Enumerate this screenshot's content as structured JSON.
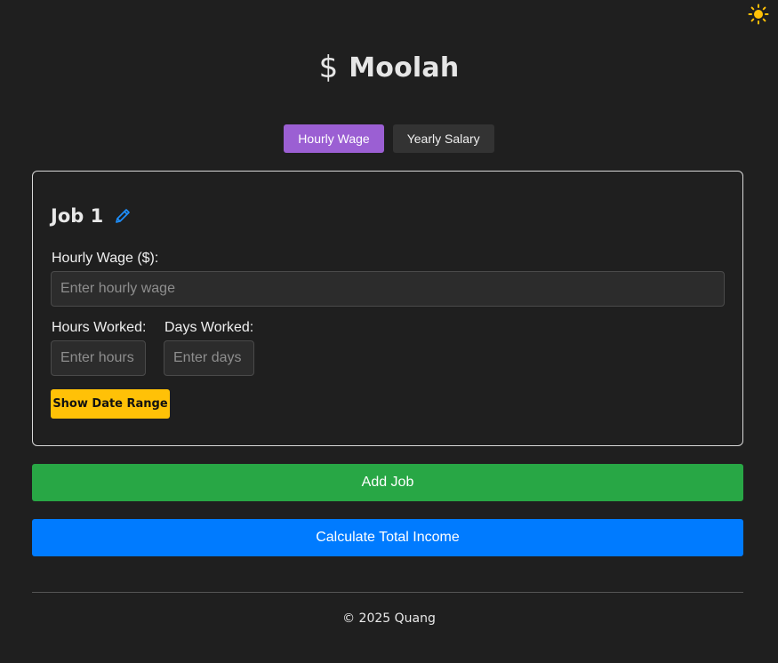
{
  "header": {
    "logo_symbol": "$",
    "title": "Moolah"
  },
  "theme_toggle": {
    "icon": "sun-icon",
    "color": "#ffc107"
  },
  "tabs": [
    {
      "label": "Hourly Wage",
      "active": true,
      "color": "#9b5fd3"
    },
    {
      "label": "Yearly Salary",
      "active": false,
      "color": "#333333"
    }
  ],
  "job": {
    "title": "Job 1",
    "edit_icon": "pencil-icon",
    "hourly_wage": {
      "label": "Hourly Wage ($):",
      "placeholder": "Enter hourly wage",
      "value": ""
    },
    "hours_worked": {
      "label": "Hours Worked:",
      "placeholder": "Enter hours",
      "value": ""
    },
    "days_worked": {
      "label": "Days Worked:",
      "placeholder": "Enter days",
      "value": ""
    },
    "date_range_button": "Show Date Range"
  },
  "actions": {
    "add_job": "Add Job",
    "calculate": "Calculate Total Income"
  },
  "colors": {
    "background": "#1f1f1f",
    "date_range": "#ffc107",
    "add_job": "#28a745",
    "calculate": "#007bff",
    "edit_icon": "#1e90ff"
  },
  "footer": {
    "text": "© 2025 Quang"
  }
}
